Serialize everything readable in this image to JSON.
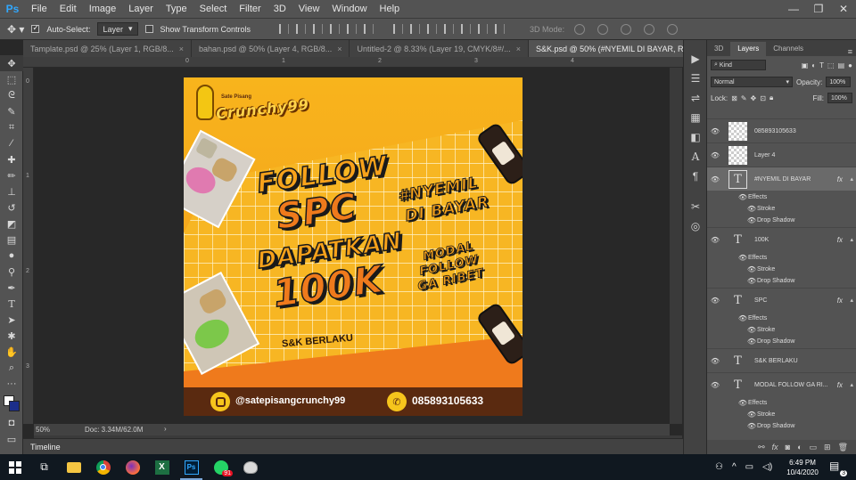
{
  "app": {
    "logo": "Ps"
  },
  "menu": [
    "File",
    "Edit",
    "Image",
    "Layer",
    "Type",
    "Select",
    "Filter",
    "3D",
    "View",
    "Window",
    "Help"
  ],
  "window_controls": {
    "minimize": "—",
    "restore": "❐",
    "close": "✕"
  },
  "options": {
    "auto_select_label": "Auto-Select:",
    "auto_select_checked": true,
    "auto_select_value": "Layer",
    "show_transform_label": "Show Transform Controls",
    "show_transform_checked": false,
    "mode_3d_label": "3D Mode:"
  },
  "tabs": [
    {
      "label": "Tamplate.psd @ 25% (Layer 1, RGB/8...",
      "active": false
    },
    {
      "label": "bahan.psd @ 50% (Layer 4, RGB/8...",
      "active": false
    },
    {
      "label": "Untitled-2 @ 8.33% (Layer 19, CMYK/8#/...",
      "active": false
    },
    {
      "label": "S&K.psd @ 50% (#NYEMIL   DI BAYAR, RGB/8)",
      "active": true
    }
  ],
  "tab_close": "×",
  "ruler": {
    "h": [
      "0",
      "1",
      "2",
      "3",
      "4"
    ],
    "v": [
      "0",
      "1",
      "2",
      "3"
    ]
  },
  "status": {
    "zoom": "50%",
    "doc": "Doc: 3.34M/62.0M",
    "arrow": "›"
  },
  "timeline_label": "Timeline",
  "artwork": {
    "brand_small": "Sate Pisang",
    "brand_big": "Crunchy99",
    "line1": "FOLLOW",
    "line2": "SPC",
    "line3": "DAPATKAN",
    "line4": "100K",
    "hashtag1": "#NYEMIL",
    "hashtag2": "DI BAYAR",
    "side1": "MODAL",
    "side2": "FOLLOW",
    "side3": "GA RIBET",
    "terms": "S&K BERLAKU",
    "instagram": "@satepisangcrunchy99",
    "whatsapp": "085893105633",
    "colors": {
      "yellow": "#f6b21a",
      "orange": "#ef7a1c",
      "dark": "#5a2a10",
      "outline": "#1a1a1a"
    }
  },
  "panel": {
    "tabs": [
      "3D",
      "Layers",
      "Channels"
    ],
    "active_tab": "Layers",
    "kind": "Kind",
    "blend": "Normal",
    "opacity_label": "Opacity:",
    "opacity": "100%",
    "lock_label": "Lock:",
    "fill_label": "Fill:",
    "fill": "100%",
    "layers": [
      {
        "name": "085893105633",
        "type": "raster",
        "fx": false
      },
      {
        "name": "Layer 4",
        "type": "raster",
        "fx": false
      },
      {
        "name": "#NYEMIL   DI BAYAR",
        "type": "text",
        "fx": true,
        "selected": true
      },
      {
        "name": "100K",
        "type": "text",
        "fx": true
      },
      {
        "name": "SPC",
        "type": "text",
        "fx": true
      },
      {
        "name": "S&K BERLAKU",
        "type": "text",
        "fx": false
      },
      {
        "name": "MODAL FOLLOW GA RI...",
        "type": "text",
        "fx": true
      }
    ],
    "effects_label": "Effects",
    "stroke_label": "Stroke",
    "shadow_label": "Drop Shadow",
    "fx_symbol": "fx",
    "text_symbol": "T"
  },
  "taskbar": {
    "time": "6:49 PM",
    "date": "10/4/2020",
    "chat_badge": "91",
    "notify_badge": "3",
    "ps_label": "Ps",
    "excel_label": "X"
  }
}
